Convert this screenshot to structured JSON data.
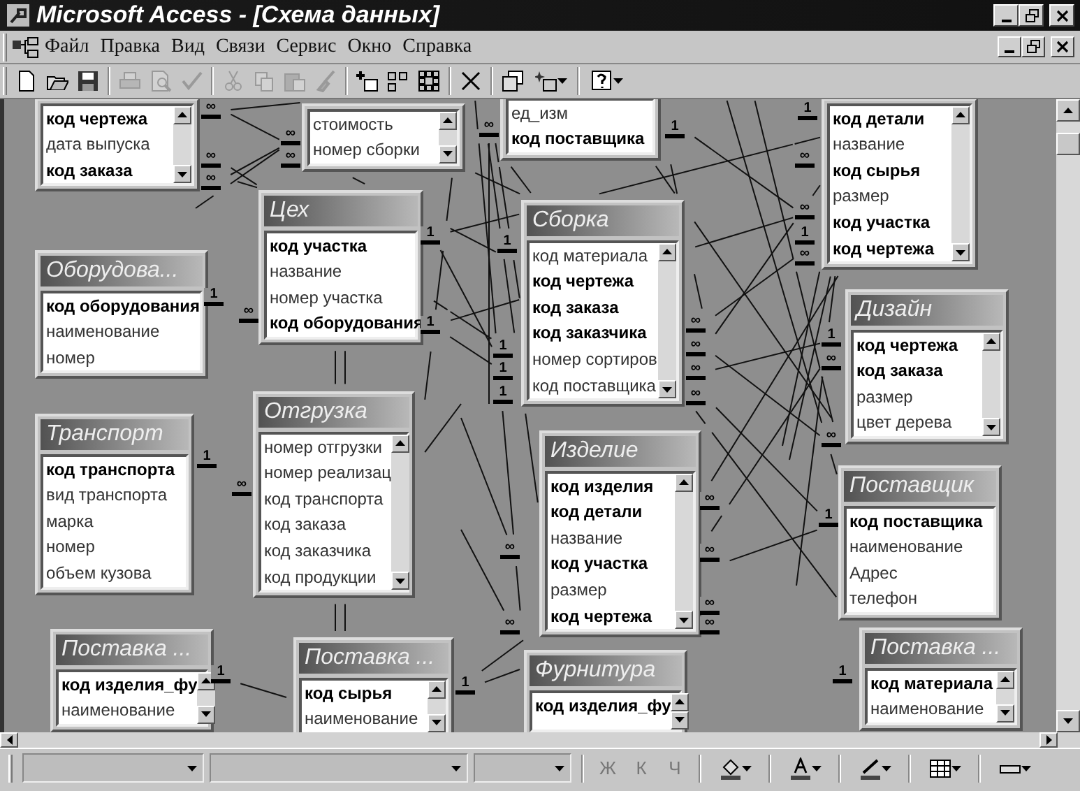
{
  "window": {
    "title": "Microsoft Access - [Схема данных]"
  },
  "menu": [
    {
      "label": "Файл"
    },
    {
      "label": "Правка"
    },
    {
      "label": "Вид"
    },
    {
      "label": "Связи"
    },
    {
      "label": "Сервис"
    },
    {
      "label": "Окно"
    },
    {
      "label": "Справка"
    }
  ],
  "toolbar": [
    {
      "kind": "new",
      "disabled": false
    },
    {
      "kind": "open",
      "disabled": false
    },
    {
      "kind": "save",
      "disabled": false
    },
    {
      "kind": "separator"
    },
    {
      "kind": "print",
      "disabled": true
    },
    {
      "kind": "preview",
      "disabled": true
    },
    {
      "kind": "spelling",
      "disabled": true
    },
    {
      "kind": "separator"
    },
    {
      "kind": "cut",
      "disabled": true
    },
    {
      "kind": "copy",
      "disabled": true
    },
    {
      "kind": "paste",
      "disabled": true
    },
    {
      "kind": "painter",
      "disabled": true
    },
    {
      "kind": "separator"
    },
    {
      "kind": "show-table",
      "disabled": false
    },
    {
      "kind": "direct",
      "disabled": false
    },
    {
      "kind": "all",
      "disabled": false
    },
    {
      "kind": "separator"
    },
    {
      "kind": "delete",
      "disabled": false
    },
    {
      "kind": "separator"
    },
    {
      "kind": "windows",
      "disabled": false
    },
    {
      "kind": "new-object",
      "disabled": false
    },
    {
      "kind": "separator"
    },
    {
      "kind": "help",
      "disabled": false
    }
  ],
  "tables": [
    {
      "scrollbar": true,
      "fields": [
        {
          "name": "код чертежа",
          "key": true
        },
        {
          "name": "дата выпуска",
          "key": false
        },
        {
          "name": "код заказа",
          "key": true
        }
      ]
    },
    {
      "scrollbar": true,
      "fields": [
        {
          "name": "стоимость",
          "key": false
        },
        {
          "name": "номер сборки",
          "key": false
        }
      ]
    },
    {
      "scrollbar": false,
      "fields": [
        {
          "name": "ед_изм",
          "key": false
        },
        {
          "name": "код поставщика",
          "key": true
        }
      ]
    },
    {
      "scrollbar": true,
      "fields": [
        {
          "name": "код детали",
          "key": true
        },
        {
          "name": "название",
          "key": false
        },
        {
          "name": "код сырья",
          "key": true
        },
        {
          "name": "размер",
          "key": false
        },
        {
          "name": "код участка",
          "key": true
        },
        {
          "name": "код чертежа",
          "key": true
        }
      ]
    },
    {
      "title": "Цех",
      "scrollbar": false,
      "fields": [
        {
          "name": "код участка",
          "key": true
        },
        {
          "name": "название",
          "key": false
        },
        {
          "name": "номер участка",
          "key": false
        },
        {
          "name": "код оборудования",
          "key": true
        }
      ]
    },
    {
      "title": "Сборка",
      "scrollbar": true,
      "fields": [
        {
          "name": "код материала",
          "key": false
        },
        {
          "name": "код чертежа",
          "key": true
        },
        {
          "name": "код заказа",
          "key": true
        },
        {
          "name": "код заказчика",
          "key": true
        },
        {
          "name": "номер сортиров",
          "key": false
        },
        {
          "name": "код поставщика",
          "key": false
        }
      ]
    },
    {
      "title": "Оборудова...",
      "scrollbar": false,
      "fields": [
        {
          "name": "код оборудования",
          "key": true
        },
        {
          "name": "наименование",
          "key": false
        },
        {
          "name": "номер",
          "key": false
        }
      ]
    },
    {
      "title": "Дизайн",
      "scrollbar": true,
      "fields": [
        {
          "name": "код чертежа",
          "key": true
        },
        {
          "name": "код заказа",
          "key": true
        },
        {
          "name": "размер",
          "key": false
        },
        {
          "name": "цвет дерева",
          "key": false
        }
      ]
    },
    {
      "title": "Транспорт",
      "scrollbar": false,
      "fields": [
        {
          "name": "код транспорта",
          "key": true
        },
        {
          "name": "вид транспорта",
          "key": false
        },
        {
          "name": "марка",
          "key": false
        },
        {
          "name": "номер",
          "key": false
        },
        {
          "name": "объем кузова",
          "key": false
        }
      ]
    },
    {
      "title": "Отгрузка",
      "scrollbar": true,
      "fields": [
        {
          "name": "номер отгрузки",
          "key": false
        },
        {
          "name": "номер реализац",
          "key": false
        },
        {
          "name": "код транспорта",
          "key": false
        },
        {
          "name": "код заказа",
          "key": false
        },
        {
          "name": "код заказчика",
          "key": false
        },
        {
          "name": "код продукции",
          "key": false
        }
      ]
    },
    {
      "title": "Изделие",
      "scrollbar": true,
      "fields": [
        {
          "name": "код изделия",
          "key": true
        },
        {
          "name": "код детали",
          "key": true
        },
        {
          "name": "название",
          "key": false
        },
        {
          "name": "код участка",
          "key": true
        },
        {
          "name": "размер",
          "key": false
        },
        {
          "name": "код чертежа",
          "key": true
        }
      ]
    },
    {
      "title": "Поставщик",
      "scrollbar": false,
      "fields": [
        {
          "name": "код поставщика",
          "key": true
        },
        {
          "name": "наименование",
          "key": false
        },
        {
          "name": "Адрес",
          "key": false
        },
        {
          "name": "телефон",
          "key": false
        }
      ]
    },
    {
      "title": "Поставка ...",
      "scrollbar": true,
      "fields": [
        {
          "name": "код изделия_фу",
          "key": true
        },
        {
          "name": "наименование",
          "key": false
        }
      ]
    },
    {
      "title": "Поставка ...",
      "scrollbar": true,
      "fields": [
        {
          "name": "код сырья",
          "key": true
        },
        {
          "name": "наименование",
          "key": false
        }
      ]
    },
    {
      "title": "Фурнитура",
      "scrollbar": true,
      "fields": [
        {
          "name": "код изделия_фу",
          "key": true
        }
      ]
    },
    {
      "title": "Поставка ...",
      "scrollbar": true,
      "fields": [
        {
          "name": "код материала",
          "key": true
        },
        {
          "name": "наименование",
          "key": false
        }
      ]
    }
  ],
  "relation_marks": [
    {
      "text": "∞"
    },
    {
      "text": "1"
    },
    {
      "text": "∞"
    },
    {
      "text": "∞"
    },
    {
      "text": "1"
    },
    {
      "text": "∞"
    },
    {
      "text": "∞"
    },
    {
      "text": "∞"
    },
    {
      "text": "∞"
    },
    {
      "text": "∞"
    },
    {
      "text": "1"
    },
    {
      "text": "1"
    },
    {
      "text": "1"
    },
    {
      "text": "∞"
    },
    {
      "text": "1"
    },
    {
      "text": "∞"
    },
    {
      "text": "1"
    },
    {
      "text": "∞"
    },
    {
      "text": "1"
    },
    {
      "text": "1"
    },
    {
      "text": "∞"
    },
    {
      "text": "∞"
    },
    {
      "text": "1"
    },
    {
      "text": "∞"
    },
    {
      "text": "1"
    },
    {
      "text": "∞"
    },
    {
      "text": "∞"
    },
    {
      "text": "1"
    },
    {
      "text": "∞"
    },
    {
      "text": "∞"
    },
    {
      "text": "1"
    },
    {
      "text": "∞"
    },
    {
      "text": "∞"
    },
    {
      "text": "∞"
    },
    {
      "text": "∞"
    },
    {
      "text": "∞"
    },
    {
      "text": "1"
    },
    {
      "text": "1"
    },
    {
      "text": "1"
    }
  ],
  "format_toolbar": [
    {
      "kind": "combo"
    },
    {
      "kind": "combo"
    },
    {
      "kind": "combo"
    },
    {
      "kind": "text",
      "label": "Ж",
      "disabled": true
    },
    {
      "kind": "text",
      "label": "К",
      "disabled": true
    },
    {
      "kind": "text",
      "label": "Ч",
      "disabled": true
    },
    {
      "kind": "fill"
    },
    {
      "kind": "font-color"
    },
    {
      "kind": "line-color"
    },
    {
      "kind": "borders"
    },
    {
      "kind": "line-style"
    }
  ]
}
